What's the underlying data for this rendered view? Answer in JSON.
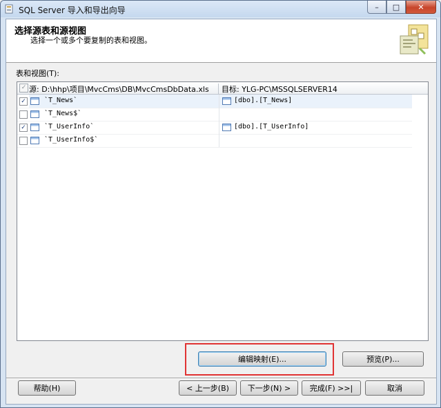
{
  "window": {
    "title": "SQL Server 导入和导出向导",
    "controls": {
      "minimize": "–",
      "maximize": "□",
      "close": "✕"
    }
  },
  "header": {
    "title": "选择源表和源视图",
    "subtitle": "选择一个或多个要复制的表和视图。"
  },
  "grid": {
    "group_label": "表和视图(T):",
    "columns": {
      "source": "源: D:\\hhp\\项目\\MvcCms\\DB\\MvcCmsDbData.xls",
      "destination": "目标: YLG-PC\\MSSQLSERVER14"
    },
    "rows": [
      {
        "checked": true,
        "source": "`T_News`",
        "destination": "[dbo].[T_News]"
      },
      {
        "checked": false,
        "source": "`T_News$`",
        "destination": ""
      },
      {
        "checked": true,
        "source": "`T_UserInfo`",
        "destination": "[dbo].[T_UserInfo]"
      },
      {
        "checked": false,
        "source": "`T_UserInfo$`",
        "destination": ""
      }
    ]
  },
  "buttons": {
    "edit_mappings": "编辑映射(E)...",
    "preview": "预览(P)...",
    "help": "帮助(H)",
    "back": "< 上一步(B)",
    "next": "下一步(N) >",
    "finish": "完成(F) >>|",
    "cancel": "取消"
  },
  "colors": {
    "highlight_box": "#e03232",
    "header_bg": "#ffffff",
    "dialog_bg": "#f0f0f0"
  },
  "icons": [
    "app-icon",
    "table-icon",
    "wizard-graphic-icon"
  ]
}
